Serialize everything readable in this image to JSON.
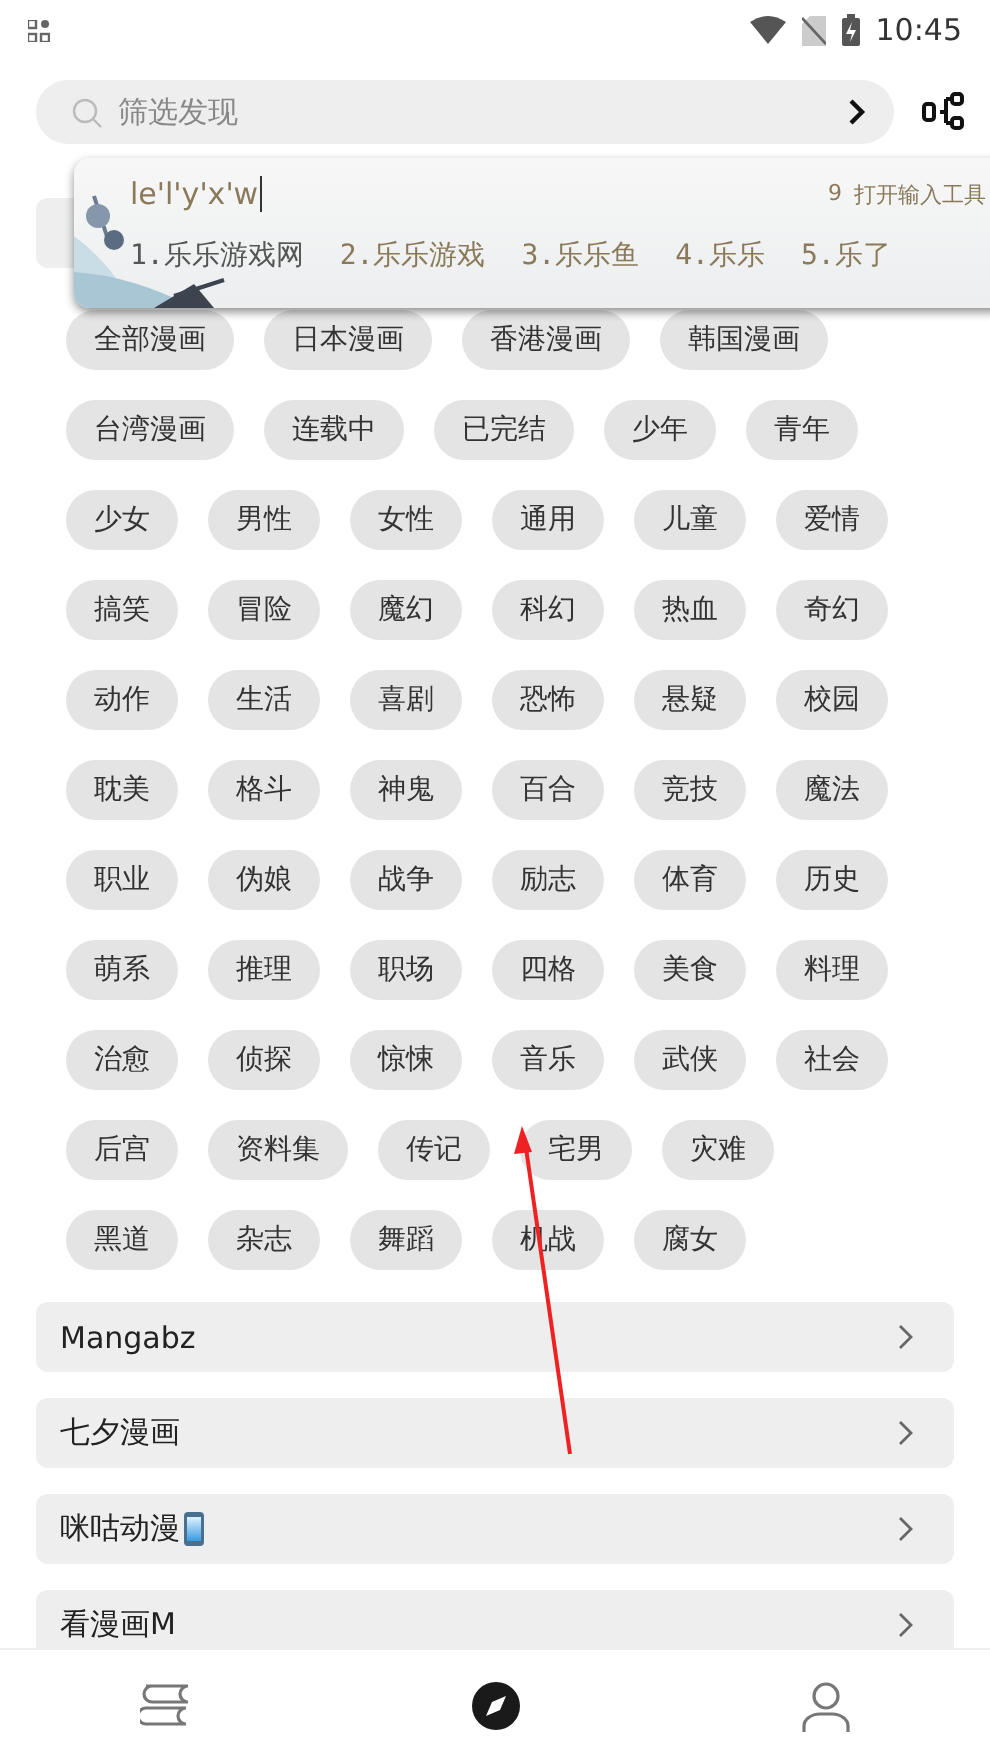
{
  "status_bar": {
    "time": "10:45"
  },
  "search": {
    "placeholder": "筛选发现"
  },
  "ime": {
    "composition": "le'l'y'x'w",
    "toolbox_key": "9",
    "toolbox_label": "打开输入工具",
    "candidates": [
      {
        "label": "1.乐乐游戏网",
        "selected": true
      },
      {
        "label": "2.乐乐游戏",
        "selected": false
      },
      {
        "label": "3.乐乐鱼",
        "selected": false
      },
      {
        "label": "4.乐乐",
        "selected": false
      },
      {
        "label": "5.乐了",
        "selected": false
      }
    ]
  },
  "tag_rows": [
    [
      "全部漫画",
      "日本漫画",
      "香港漫画",
      "韩国漫画"
    ],
    [
      "台湾漫画",
      "连载中",
      "已完结",
      "少年",
      "青年"
    ],
    [
      "少女",
      "男性",
      "女性",
      "通用",
      "儿童",
      "爱情"
    ],
    [
      "搞笑",
      "冒险",
      "魔幻",
      "科幻",
      "热血",
      "奇幻"
    ],
    [
      "动作",
      "生活",
      "喜剧",
      "恐怖",
      "悬疑",
      "校园"
    ],
    [
      "耽美",
      "格斗",
      "神鬼",
      "百合",
      "竞技",
      "魔法"
    ],
    [
      "职业",
      "伪娘",
      "战争",
      "励志",
      "体育",
      "历史"
    ],
    [
      "萌系",
      "推理",
      "职场",
      "四格",
      "美食",
      "料理"
    ],
    [
      "治愈",
      "侦探",
      "惊悚",
      "音乐",
      "武侠",
      "社会"
    ],
    [
      "后宫",
      "资料集",
      "传记",
      "宅男",
      "灾难"
    ],
    [
      "黑道",
      "杂志",
      "舞蹈",
      "机战",
      "腐女"
    ]
  ],
  "sources": [
    {
      "label": "Mangabz",
      "phone_icon": false
    },
    {
      "label": "七夕漫画",
      "phone_icon": false
    },
    {
      "label": "咪咕动漫",
      "phone_icon": true
    },
    {
      "label": "看漫画M",
      "phone_icon": false
    }
  ],
  "bottom_nav": [
    {
      "kind": "shelf",
      "selected": false
    },
    {
      "kind": "explore",
      "selected": true
    },
    {
      "kind": "profile",
      "selected": false
    }
  ]
}
